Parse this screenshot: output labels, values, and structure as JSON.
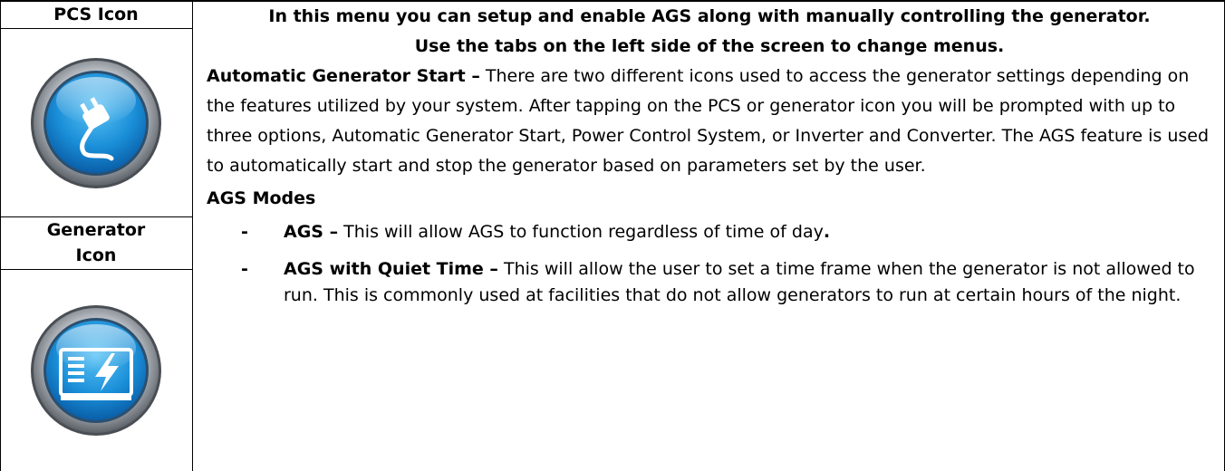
{
  "table": {
    "left": {
      "pcs_label": "PCS Icon",
      "pcs_icon": "power-plug-icon",
      "generator_label": "Generator Icon",
      "generator_icon": "generator-lightning-icon"
    },
    "right": {
      "heading1": "In this menu you can setup and enable AGS along with manually controlling the generator.",
      "heading2": "Use the tabs on the left side of the screen to change menus.",
      "ags_start_title": "Automatic Generator Start –",
      "ags_start_body": " There are two different icons used to access the generator settings depending on the features utilized by your system. After tapping on the PCS or generator icon you will be prompted with up to three options, Automatic Generator Start, Power Control System, or Inverter and Converter. The AGS feature is used to automatically start and stop the generator based on parameters set by the user.",
      "modes_title": "AGS Modes",
      "modes": [
        {
          "dash": "-",
          "title": "AGS –",
          "body": " This will allow AGS to function regardless of time of day",
          "end": "."
        },
        {
          "dash": "-",
          "title": "AGS with Quiet Time –",
          "body": " This will allow the user to set a time frame when the generator is not allowed to run. This is commonly used at facilities that do not allow generators to run at certain hours of the night.",
          "end": ""
        }
      ]
    }
  },
  "colors": {
    "icon_blue": "#1a8fd8",
    "icon_ring": "#8a8f96",
    "border": "#000000"
  }
}
